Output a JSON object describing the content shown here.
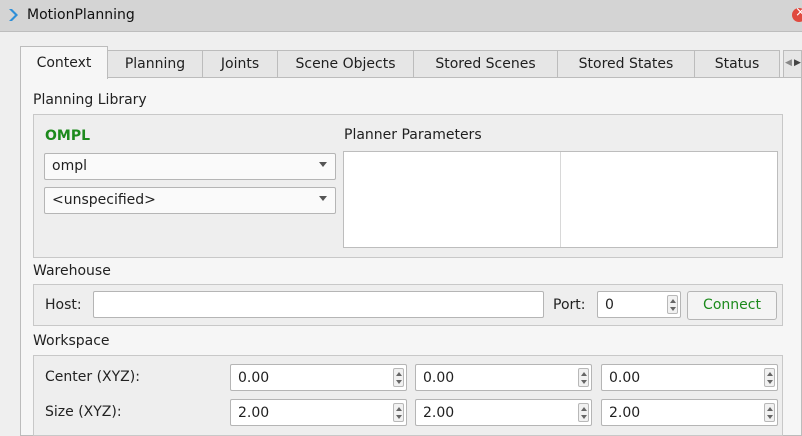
{
  "window": {
    "title": "MotionPlanning"
  },
  "tabs": [
    {
      "label": "Context",
      "active": true
    },
    {
      "label": "Planning"
    },
    {
      "label": "Joints"
    },
    {
      "label": "Scene Objects"
    },
    {
      "label": "Stored Scenes"
    },
    {
      "label": "Stored States"
    },
    {
      "label": "Status"
    }
  ],
  "planning_library": {
    "heading": "Planning Library",
    "library_name": "OMPL",
    "library_select": "ompl",
    "planner_select": "<unspecified>",
    "planner_params_label": "Planner Parameters"
  },
  "warehouse": {
    "heading": "Warehouse",
    "host_label": "Host:",
    "host_value": "",
    "port_label": "Port:",
    "port_value": "0",
    "connect_label": "Connect"
  },
  "workspace": {
    "heading": "Workspace",
    "center_label": "Center (XYZ):",
    "center": [
      "0.00",
      "0.00",
      "0.00"
    ],
    "size_label": "Size (XYZ):",
    "size": [
      "2.00",
      "2.00",
      "2.00"
    ]
  },
  "colors": {
    "accent_green": "#1c8a1c",
    "close_red": "#e04a3f",
    "title_icon_blue": "#2f8fd8"
  }
}
